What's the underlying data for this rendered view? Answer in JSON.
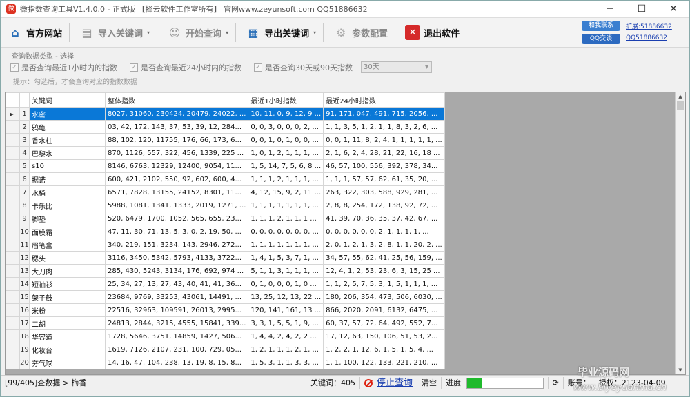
{
  "window": {
    "title": "微指数查询工具V1.4.0.0 - 正式版 【择云软件工作室所有】 官网www.zeyunsoft.com QQ51886632",
    "minimize_icon": "minimize-icon",
    "maximize_icon": "maximize-icon",
    "close_icon": "close-icon"
  },
  "toolbar": {
    "website_label": "官方网站",
    "import_label": "导入关键词",
    "query_label": "开始查询",
    "export_label": "导出关键词",
    "config_label": "参数配置",
    "exit_label": "退出软件"
  },
  "contact": {
    "online_badge": "和我联系",
    "qq_badge": "QQ交谈",
    "link1": "扩展:51886632",
    "link2": "QQ51886632"
  },
  "options": {
    "group_label": "查询数据类型 - 选择",
    "opt1": "是否查询最近1小时内的指数",
    "opt2": "是否查询最近24小时内的指数",
    "opt3": "是否查询30天或90天指数",
    "range_select": "30天",
    "hint": "提示：勾选后，才会查询对应的指数数据"
  },
  "grid": {
    "columns": [
      "关键词",
      "整体指数",
      "最近1小时指数",
      "最近24小时指数"
    ],
    "rows": [
      {
        "n": "1",
        "kw": "水密",
        "c1": "8027, 31060, 230424, 20479, 24022, ...",
        "c2": "10, 11, 0, 9, 12, 9 ...",
        "c3": "91, 171, 047, 491, 715, 2056, ..."
      },
      {
        "n": "2",
        "kw": "鸦龟",
        "c1": "03, 42, 172, 143, 37, 53, 39, 12, 284...",
        "c2": "0, 0, 3, 0, 0, 0, 2, ...",
        "c3": "1, 1, 3, 5, 1, 2, 1, 1, 8, 3, 2, 6, ..."
      },
      {
        "n": "3",
        "kw": "香水柱",
        "c1": "88, 102, 120, 11755, 176, 66, 173, 6...",
        "c2": "0, 0, 1, 0, 1, 0, 0, ...",
        "c3": "0, 0, 1, 11, 8, 2, 4, 1, 1, 1, 1, 1, ..."
      },
      {
        "n": "4",
        "kw": "巴黎水",
        "c1": "870, 1126, 557, 322, 456, 1339, 225 ...",
        "c2": "1, 0, 1, 2, 1, 1, 1, ...",
        "c3": "2, 1, 6, 2, 4, 28, 21, 22, 16, 18 ..."
      },
      {
        "n": "5",
        "kw": "s10",
        "c1": "8146, 6763, 12329, 12400, 9054, 11...",
        "c2": "1, 5, 14, 7, 5, 6, 8 ...",
        "c3": "46, 57, 100, 556, 392, 378, 34..."
      },
      {
        "n": "6",
        "kw": "据诺",
        "c1": "600, 421, 2102, 550, 92, 602, 600, 4...",
        "c2": "1, 1, 1, 2, 1, 1, 1, ...",
        "c3": "1, 1, 1, 57, 57, 62, 61, 35, 20, ..."
      },
      {
        "n": "7",
        "kw": "水桶",
        "c1": "6571, 7828, 13155, 24152, 8301, 11...",
        "c2": "4, 12, 15, 9, 2, 11 ...",
        "c3": "263, 322, 303, 588, 929, 281, ..."
      },
      {
        "n": "8",
        "kw": "卡乐比",
        "c1": "5988, 1081, 1341, 1333, 2019, 1271, ...",
        "c2": "1, 1, 1, 1, 1, 1, 1, ...",
        "c3": "2, 8, 8, 254, 172, 138, 92, 72, ..."
      },
      {
        "n": "9",
        "kw": "脚垫",
        "c1": "520, 6479, 1700, 1052, 565, 655, 23...",
        "c2": "1, 1, 1, 2, 1, 1, 1 ...",
        "c3": "41, 39, 70, 36, 35, 37, 42, 67, ..."
      },
      {
        "n": "10",
        "kw": "面膜霜",
        "c1": "47, 11, 30, 71, 13, 5, 3, 0, 2, 19, 50, ...",
        "c2": "0, 0, 0, 0, 0, 0, 0, ...",
        "c3": "0, 0, 0, 0, 0, 0, 2, 1, 1, 1, 1, ..."
      },
      {
        "n": "11",
        "kw": "眉笔盒",
        "c1": "340, 219, 151, 3234, 143, 2946, 272...",
        "c2": "1, 1, 1, 1, 1, 1, 1, ...",
        "c3": "2, 0, 1, 2, 1, 3, 2, 8, 1, 1, 20, 2, ..."
      },
      {
        "n": "12",
        "kw": "腮头",
        "c1": "3116, 3450, 5342, 5793, 4133, 3722...",
        "c2": "1, 4, 1, 5, 3, 7, 1, ...",
        "c3": "34, 57, 55, 62, 41, 25, 56, 159, ..."
      },
      {
        "n": "13",
        "kw": "大刀肉",
        "c1": "285, 430, 5243, 3134, 176, 692, 974 ...",
        "c2": "5, 1, 1, 3, 1, 1, 1, ...",
        "c3": "12, 4, 1, 2, 53, 23, 6, 3, 15, 25 ..."
      },
      {
        "n": "14",
        "kw": "短袖衫",
        "c1": "25, 34, 27, 13, 27, 43, 40, 41, 41, 36...",
        "c2": "0, 1, 0, 0, 0, 1, 0 ...",
        "c3": "1, 1, 2, 5, 7, 5, 3, 1, 5, 1, 1, 1, ..."
      },
      {
        "n": "15",
        "kw": "架子鼓",
        "c1": "23684, 9769, 33253, 43061, 14491, ...",
        "c2": "13, 25, 12, 13, 22 ...",
        "c3": "180, 206, 354, 473, 506, 6030, ..."
      },
      {
        "n": "16",
        "kw": "米粉",
        "c1": "22516, 32963, 109591, 26013, 2995...",
        "c2": "120, 141, 161, 13 ...",
        "c3": "866, 2020, 2091, 6132, 6475, ..."
      },
      {
        "n": "17",
        "kw": "二胡",
        "c1": "24813, 2844, 3215, 4555, 15841, 339...",
        "c2": "3, 3, 1, 5, 5, 1, 9, ...",
        "c3": "60, 37, 57, 72, 64, 492, 552, 7..."
      },
      {
        "n": "18",
        "kw": "华容道",
        "c1": "1728, 5646, 3751, 14859, 1427, 506...",
        "c2": "1, 4, 4, 2, 4, 2, 2 ...",
        "c3": "17, 12, 63, 150, 106, 51, 53, 2..."
      },
      {
        "n": "19",
        "kw": "化妆台",
        "c1": "1619, 7126, 2107, 231, 100, 729, 05...",
        "c2": "1, 2, 1, 1, 1, 2, 1, ...",
        "c3": "1, 2, 2, 1, 12, 6, 1, 5, 1, 5, 4, ..."
      },
      {
        "n": "20",
        "kw": "夯气球",
        "c1": "14, 16, 47, 104, 238, 13, 19, 8, 15, 8...",
        "c2": "1, 5, 3, 1, 1, 3, 3, ...",
        "c3": "1, 1, 100, 122, 133, 221, 210, ..."
      }
    ]
  },
  "status": {
    "progress_text": "[99/405]查数据 > 梅香",
    "keyword_count": "关键词：405",
    "stop_label": "停止查询",
    "clear_label": "清空",
    "speed_label": "进度",
    "progress_fraction": 0.2,
    "account_label": "账号：",
    "auth_text": "授权：2123-04-09"
  },
  "watermark": {
    "line1": "毕业源码网",
    "line2": "www.biyeyuanma.cn"
  }
}
